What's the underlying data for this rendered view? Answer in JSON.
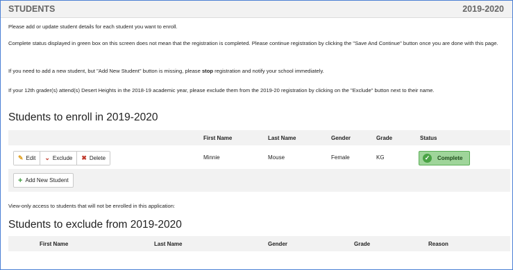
{
  "header": {
    "title": "STUDENTS",
    "year": "2019-2020"
  },
  "paragraphs": {
    "p1": "Please add or update student details for each student you want to enroll.",
    "p2": "Complete status displayed in green box on this screen does not mean that the registration is completed. Please continue registration by clicking the \"Save And Continue\" button once you are done with this page.",
    "p3_before": "If you need to add a new student, but \"Add New Student\" button is missing, please ",
    "p3_bold": "stop",
    "p3_after": " registration and notify your school immediately.",
    "p4": "If your 12th grader(s) attend(s) Desert Heights in the 2018-19 academic year, please exclude them from the 2019-20 registration by clicking on the \"Exclude\" button next to their name.",
    "view_only": "View-only access to students that will not be enrolled in this application:"
  },
  "enroll": {
    "heading": "Students to enroll in 2019-2020",
    "columns": {
      "first": "First Name",
      "last": "Last Name",
      "gender": "Gender",
      "grade": "Grade",
      "status": "Status"
    },
    "rows": [
      {
        "actions": {
          "edit": "Edit",
          "exclude": "Exclude",
          "delete": "Delete"
        },
        "first": "Minnie",
        "last": "Mouse",
        "gender": "Female",
        "grade": "KG",
        "status": "Complete"
      }
    ],
    "add_button": "Add New Student"
  },
  "exclude": {
    "heading": "Students to exclude from 2019-2020",
    "columns": {
      "first": "First Name",
      "last": "Last Name",
      "gender": "Gender",
      "grade": "Grade",
      "reason": "Reason"
    }
  },
  "icons": {
    "edit": "pencil-icon",
    "exclude": "chevron-down-icon",
    "delete": "x-icon",
    "status": "check-circle-icon",
    "add": "plus-icon"
  },
  "colors": {
    "frame_border": "#4a7fd4",
    "status_bg": "#9fd59a",
    "status_icon": "#4aa345",
    "exclude_red": "#c0392b",
    "add_green": "#3c9b3a"
  }
}
